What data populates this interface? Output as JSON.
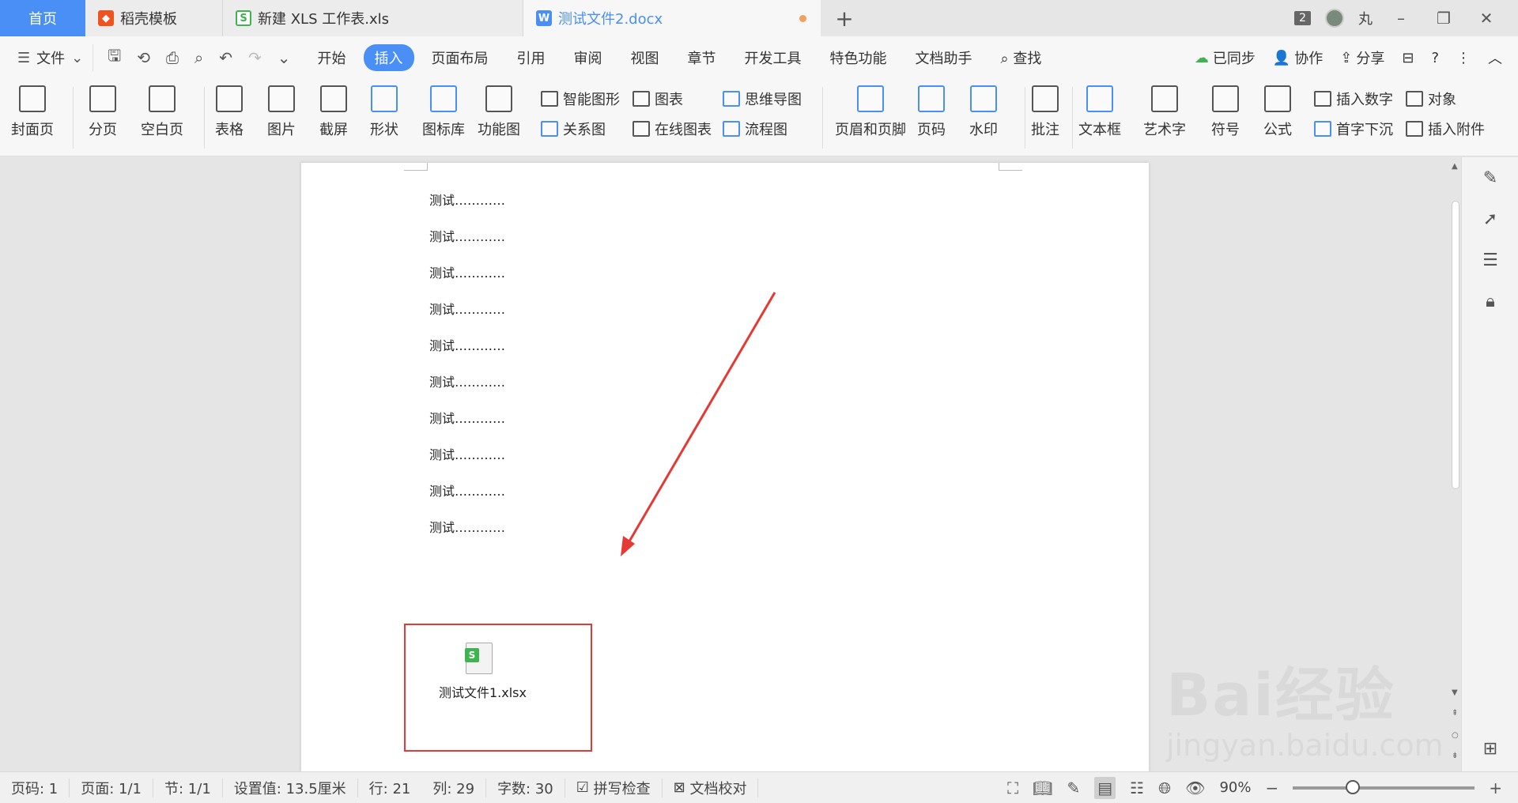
{
  "tabs": {
    "home": "首页",
    "docer": "稻壳模板",
    "xls": "新建 XLS 工作表.xls",
    "doc": "测试文件2.docx",
    "add": "+"
  },
  "titlebar": {
    "window_count": "2",
    "user_name": "丸"
  },
  "menu": {
    "file": "文件",
    "tabs": [
      "开始",
      "插入",
      "页面布局",
      "引用",
      "审阅",
      "视图",
      "章节",
      "开发工具",
      "特色功能",
      "文档助手"
    ],
    "active_tab": "插入",
    "search": "查找",
    "synced": "已同步",
    "collab": "协作",
    "share": "分享"
  },
  "ribbon": {
    "cover": "封面页",
    "page_break": "分页",
    "blank_page": "空白页",
    "table": "表格",
    "picture": "图片",
    "screenshot": "截屏",
    "shape": "形状",
    "icon_lib": "图标库",
    "func_chart": "功能图",
    "smart_art": "智能图形",
    "chart": "图表",
    "mind_map": "思维导图",
    "relation": "关系图",
    "online_chart": "在线图表",
    "flowchart": "流程图",
    "header_footer": "页眉和页脚",
    "page_num": "页码",
    "watermark": "水印",
    "comment": "批注",
    "textbox": "文本框",
    "wordart": "艺术字",
    "symbol": "符号",
    "formula": "公式",
    "insert_number": "插入数字",
    "object": "对象",
    "drop_cap": "首字下沉",
    "attach": "插入附件"
  },
  "document": {
    "lines": [
      "测试…………",
      "测试…………",
      "测试…………",
      "测试…………",
      "测试…………",
      "测试…………",
      "测试…………",
      "测试…………",
      "测试…………",
      "测试…………"
    ],
    "attachment_name": "测试文件1.xlsx",
    "attachment_icon": "S"
  },
  "status": {
    "page_num": "页码: 1",
    "pages": "页面: 1/1",
    "section": "节: 1/1",
    "setting": "设置值: 13.5厘米",
    "row": "行: 21",
    "col": "列: 29",
    "word_count": "字数: 30",
    "spell_check": "拼写检查",
    "doc_proof": "文档校对",
    "zoom": "90%",
    "zoom_fraction": 0.33
  },
  "watermark": {
    "brand": "Bai经验",
    "url": "jingyan.baidu.com"
  },
  "colors": {
    "accent": "#4a8ff5",
    "annotation": "#e53935",
    "xls_green": "#3fb34f"
  }
}
